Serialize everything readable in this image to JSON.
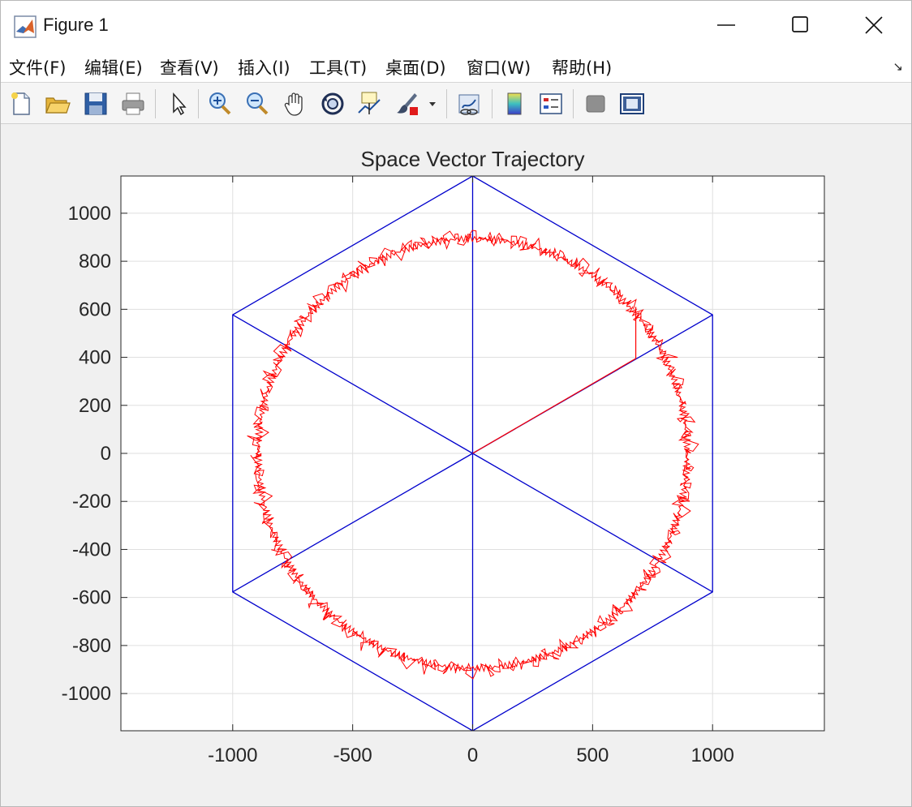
{
  "window": {
    "title": "Figure 1"
  },
  "menu": [
    "文件(F)",
    "编辑(E)",
    "查看(V)",
    "插入(I)",
    "工具(T)",
    "桌面(D)",
    "窗口(W)",
    "帮助(H)"
  ],
  "toolbar": [
    {
      "icon": "new-figure-icon"
    },
    {
      "icon": "open-file-icon"
    },
    {
      "icon": "save-icon"
    },
    {
      "icon": "print-icon"
    },
    {
      "icon": "pointer-icon"
    },
    {
      "icon": "zoom-in-icon"
    },
    {
      "icon": "zoom-out-icon"
    },
    {
      "icon": "pan-hand-icon"
    },
    {
      "icon": "rotate-3d-icon"
    },
    {
      "icon": "data-cursor-icon"
    },
    {
      "icon": "brush-icon"
    },
    {
      "icon": "link-plot-icon"
    },
    {
      "icon": "colorbar-icon"
    },
    {
      "icon": "legend-icon"
    },
    {
      "icon": "hide-plot-tools-icon"
    },
    {
      "icon": "show-plot-tools-icon"
    }
  ],
  "chart_data": {
    "type": "line",
    "title": "Space Vector Trajectory",
    "xlabel": "",
    "ylabel": "",
    "xlim": [
      -1466,
      1466
    ],
    "ylim": [
      -1155,
      1155
    ],
    "xticks": [
      -1000,
      -500,
      0,
      500,
      1000
    ],
    "yticks": [
      1000,
      800,
      600,
      400,
      200,
      0,
      -200,
      -400,
      -600,
      -800,
      -1000
    ],
    "grid": true,
    "colors": {
      "hexagon": "#0000cc",
      "trajectory": "#ff0000"
    },
    "series": [
      {
        "style": "hexagon-with-spokes",
        "vertices": [
          [
            0,
            1155
          ],
          [
            1000,
            577
          ],
          [
            1000,
            -577
          ],
          [
            0,
            -1155
          ],
          [
            -1000,
            -577
          ],
          [
            -1000,
            577
          ]
        ],
        "center": [
          0,
          0
        ]
      },
      {
        "style": "stepped-circle-trajectory",
        "radius": 900,
        "start_segment": {
          "from": [
            0,
            0
          ],
          "corner": [
            680,
            395
          ],
          "to": [
            680,
            610
          ]
        }
      }
    ]
  }
}
